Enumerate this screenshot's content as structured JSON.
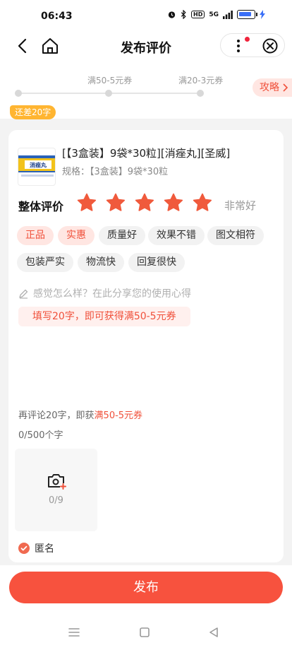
{
  "status_bar": {
    "time": "06:43",
    "hd": "HD",
    "signal": "5G"
  },
  "nav": {
    "title": "发布评价"
  },
  "progress": {
    "milestone1": "满50-5元券",
    "milestone2": "满20-3元券",
    "badge": "还差20字",
    "strategy": "攻略"
  },
  "product": {
    "name": "[【3盒装】9袋*30粒][消痤丸][圣威]",
    "spec_label": "规格：",
    "spec_value": "【3盒装】9袋*30粒",
    "thumb_text": "消痤丸"
  },
  "rating": {
    "label": "整体评价",
    "stars": 5,
    "max_stars": 5,
    "text": "非常好"
  },
  "tags": [
    {
      "label": "正品",
      "active": true
    },
    {
      "label": "实惠",
      "active": true
    },
    {
      "label": "质量好",
      "active": false
    },
    {
      "label": "效果不错",
      "active": false
    },
    {
      "label": "图文相符",
      "active": false
    },
    {
      "label": "包装严实",
      "active": false
    },
    {
      "label": "物流快",
      "active": false
    },
    {
      "label": "回复很快",
      "active": false
    }
  ],
  "comment": {
    "placeholder": "感觉怎么样？在此分享您的使用心得",
    "hint": "填写20字，即可获得满50-5元券",
    "more_prefix": "再评论20字，即获",
    "more_highlight": "满50-5元券",
    "counter": "0/500个字"
  },
  "photos": {
    "count": "0/9"
  },
  "anonymous": {
    "label": "匿名",
    "checked": true
  },
  "publish_button": "发布",
  "colors": {
    "accent": "#f7523e",
    "star": "#f05a3c",
    "badge": "#ffb531",
    "tag_active_bg": "#ffe6e2"
  }
}
